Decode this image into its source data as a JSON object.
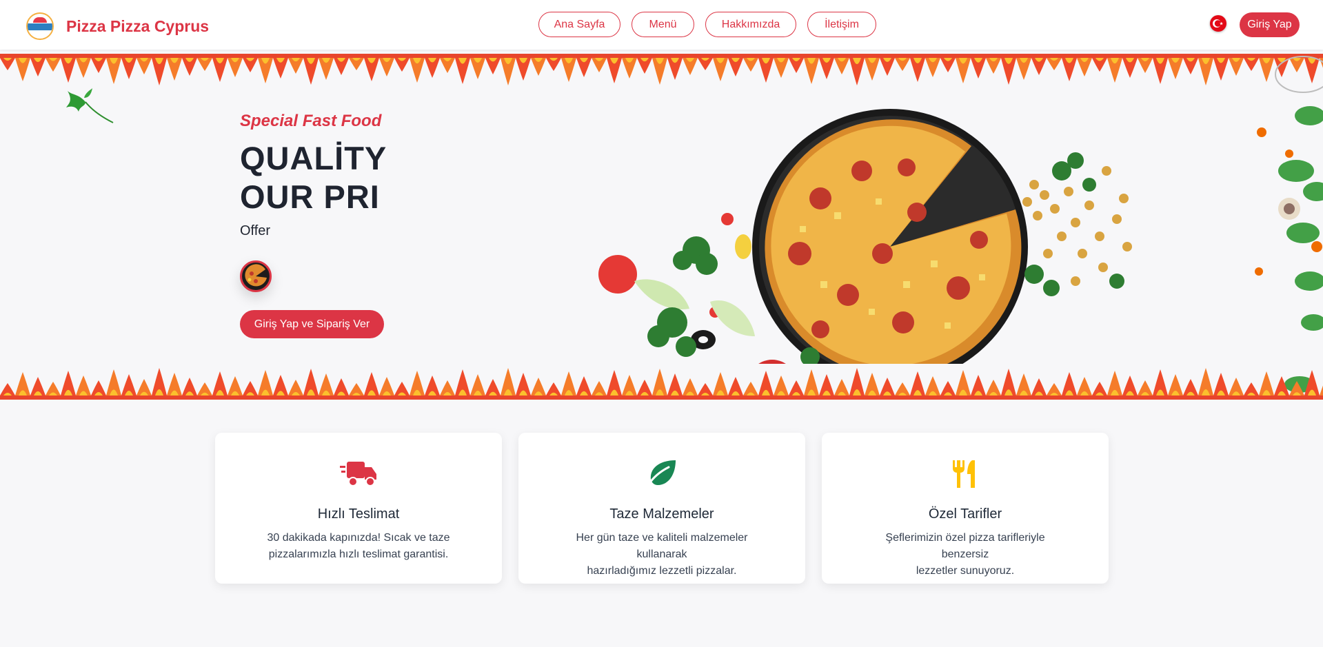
{
  "header": {
    "brand_name": "Pizza Pizza Cyprus",
    "nav": [
      {
        "label": "Ana Sayfa"
      },
      {
        "label": "Menü"
      },
      {
        "label": "Hakkımızda"
      },
      {
        "label": "İletişim"
      }
    ],
    "language_icon": "turkey-flag-icon",
    "login_label": "Giriş Yap"
  },
  "hero": {
    "tagline": "Special Fast Food",
    "headline_line1": "QUALİTY",
    "headline_line2": "OUR PRI",
    "subline": "Offer",
    "cta_label": "Giriş Yap ve Sipariş Ver"
  },
  "features": [
    {
      "icon": "delivery-truck-icon",
      "title": "Hızlı Teslimat",
      "desc_line1": "30 dakikada kapınızda! Sıcak ve taze",
      "desc_line2": "pizzalarımızla hızlı teslimat garantisi."
    },
    {
      "icon": "leaf-icon",
      "title": "Taze Malzemeler",
      "desc_line1": "Her gün taze ve kaliteli malzemeler kullanarak",
      "desc_line2": "hazırladığımız lezzetli pizzalar."
    },
    {
      "icon": "utensils-icon",
      "title": "Özel Tarifler",
      "desc_line1": "Şeflerimizin özel pizza tarifleriyle benzersiz",
      "desc_line2": "lezzetler sunuyoruz."
    }
  ],
  "colors": {
    "accent": "#dc3545",
    "leaf": "#198754",
    "utensils": "#ffc107"
  }
}
